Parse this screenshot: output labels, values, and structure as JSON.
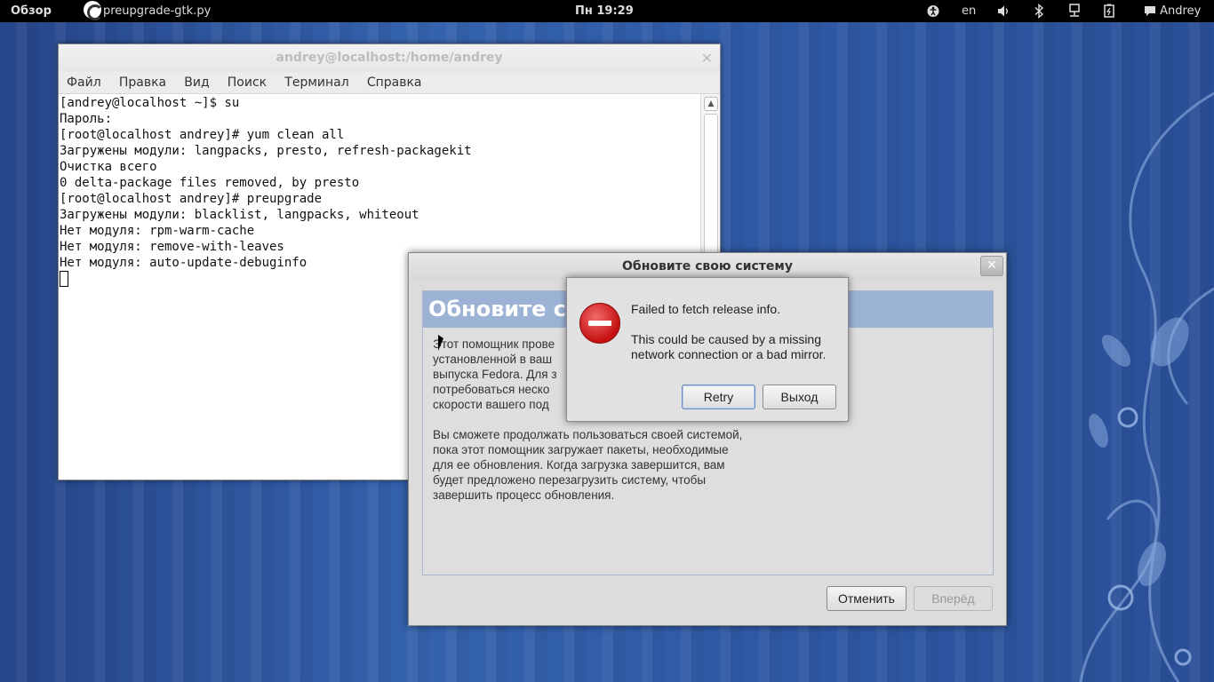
{
  "topbar": {
    "activities": "Обзор",
    "app_name": "preupgrade-gtk.py",
    "clock": "Пн 19:29",
    "lang": "en",
    "user": "Andrey"
  },
  "terminal": {
    "title": "andrey@localhost:/home/andrey",
    "menu": [
      "Файл",
      "Правка",
      "Вид",
      "Поиск",
      "Терминал",
      "Справка"
    ],
    "lines": [
      "[andrey@localhost ~]$ su",
      "Пароль:",
      "[root@localhost andrey]# yum clean all",
      "Загружены модули: langpacks, presto, refresh-packagekit",
      "Очистка всего",
      "0 delta-package files removed, by presto",
      "[root@localhost andrey]# preupgrade",
      "Загружены модули: blacklist, langpacks, whiteout",
      "Нет модуля: rpm-warm-cache",
      "Нет модуля: remove-with-leaves",
      "Нет модуля: auto-update-debuginfo"
    ]
  },
  "upgrade_dialog": {
    "title": "Обновите свою систему",
    "banner": "Обновите св",
    "para1": [
      "Этот помощник прове",
      "установленной в ваш",
      "выпуска Fedora. Для з",
      "потребоваться неско",
      "скорости вашего под"
    ],
    "para2": [
      "Вы сможете продолжать пользоваться своей системой,",
      "пока этот помощник загружает пакеты, необходимые",
      "для ее обновления. Когда загрузка завершится, вам",
      "будет предложено перезагрузить систему, чтобы",
      "завершить процесс обновления."
    ],
    "cancel_label": "Отменить",
    "forward_label": "Вперёд"
  },
  "error_dialog": {
    "line1": "Failed to fetch release info.",
    "line2": "This could be caused by a missing",
    "line3": "network connection or a bad mirror.",
    "retry_label": "Retry",
    "exit_label": "Выход"
  },
  "icons": {
    "close": "close-icon",
    "error": "error-icon"
  },
  "colors": {
    "banner": "#9cb3d6",
    "error_red": "#c41010"
  }
}
